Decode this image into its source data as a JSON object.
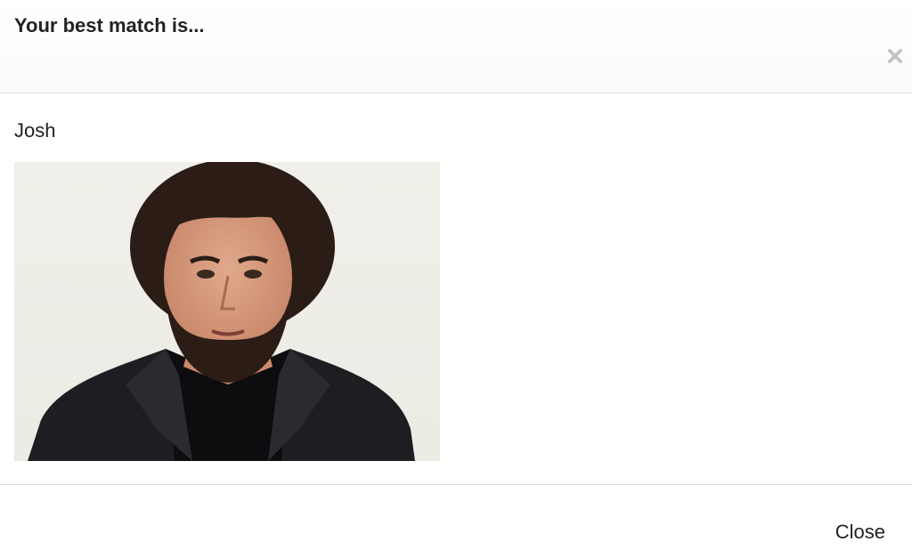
{
  "modal": {
    "title": "Your best match is...",
    "close_icon": "close-icon",
    "match": {
      "name": "Josh",
      "photo_icon": "person-portrait-image"
    },
    "footer": {
      "close_label": "Close"
    }
  }
}
